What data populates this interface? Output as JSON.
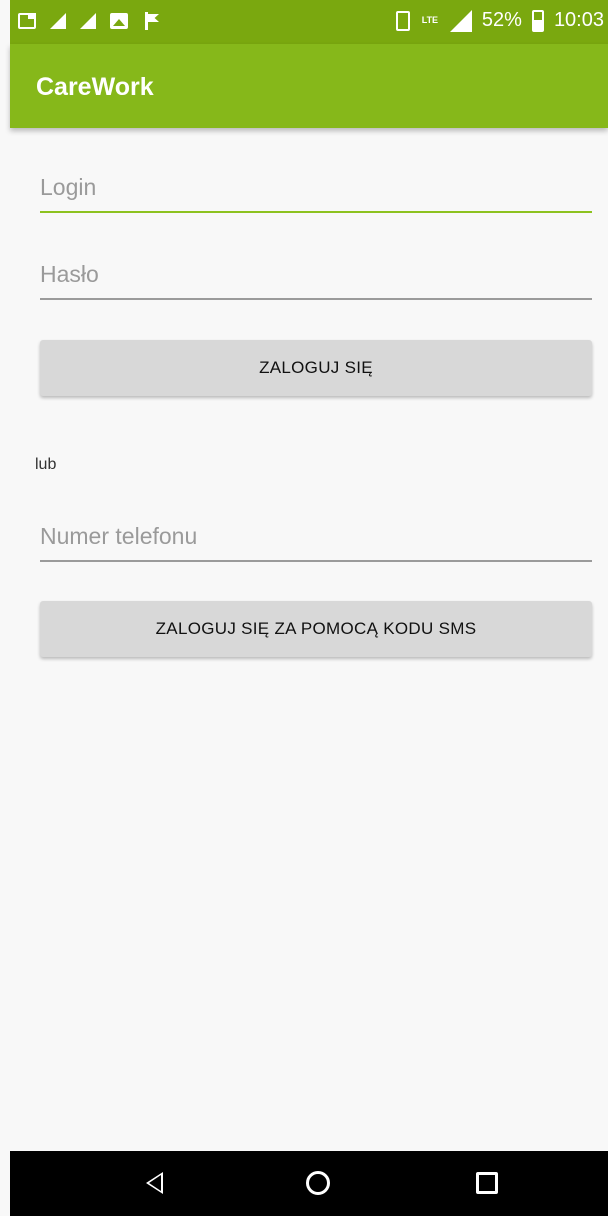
{
  "status_bar": {
    "battery_text": "52%",
    "battery_level": 0.52,
    "time": "10:03",
    "network_label": "LTE",
    "left_icons": [
      "sim-card-icon",
      "signal-icon",
      "signal-icon",
      "image-icon",
      "flag-icon"
    ],
    "right_icons": [
      "vibrate-icon",
      "lte-icon",
      "cell-signal-icon",
      "battery-icon"
    ]
  },
  "app_bar": {
    "title": "CareWork",
    "color": "#86b81a"
  },
  "form": {
    "login": {
      "value": "",
      "placeholder": "Login"
    },
    "password": {
      "value": "",
      "placeholder": "Hasło"
    },
    "login_button": "ZALOGUJ SIĘ",
    "or_text": "lub",
    "phone": {
      "value": "",
      "placeholder": "Numer telefonu"
    },
    "sms_button": "ZALOGUJ SIĘ ZA POMOCĄ KODU SMS"
  },
  "nav_bar": {
    "icons": [
      "back-icon",
      "home-icon",
      "recents-icon"
    ]
  }
}
